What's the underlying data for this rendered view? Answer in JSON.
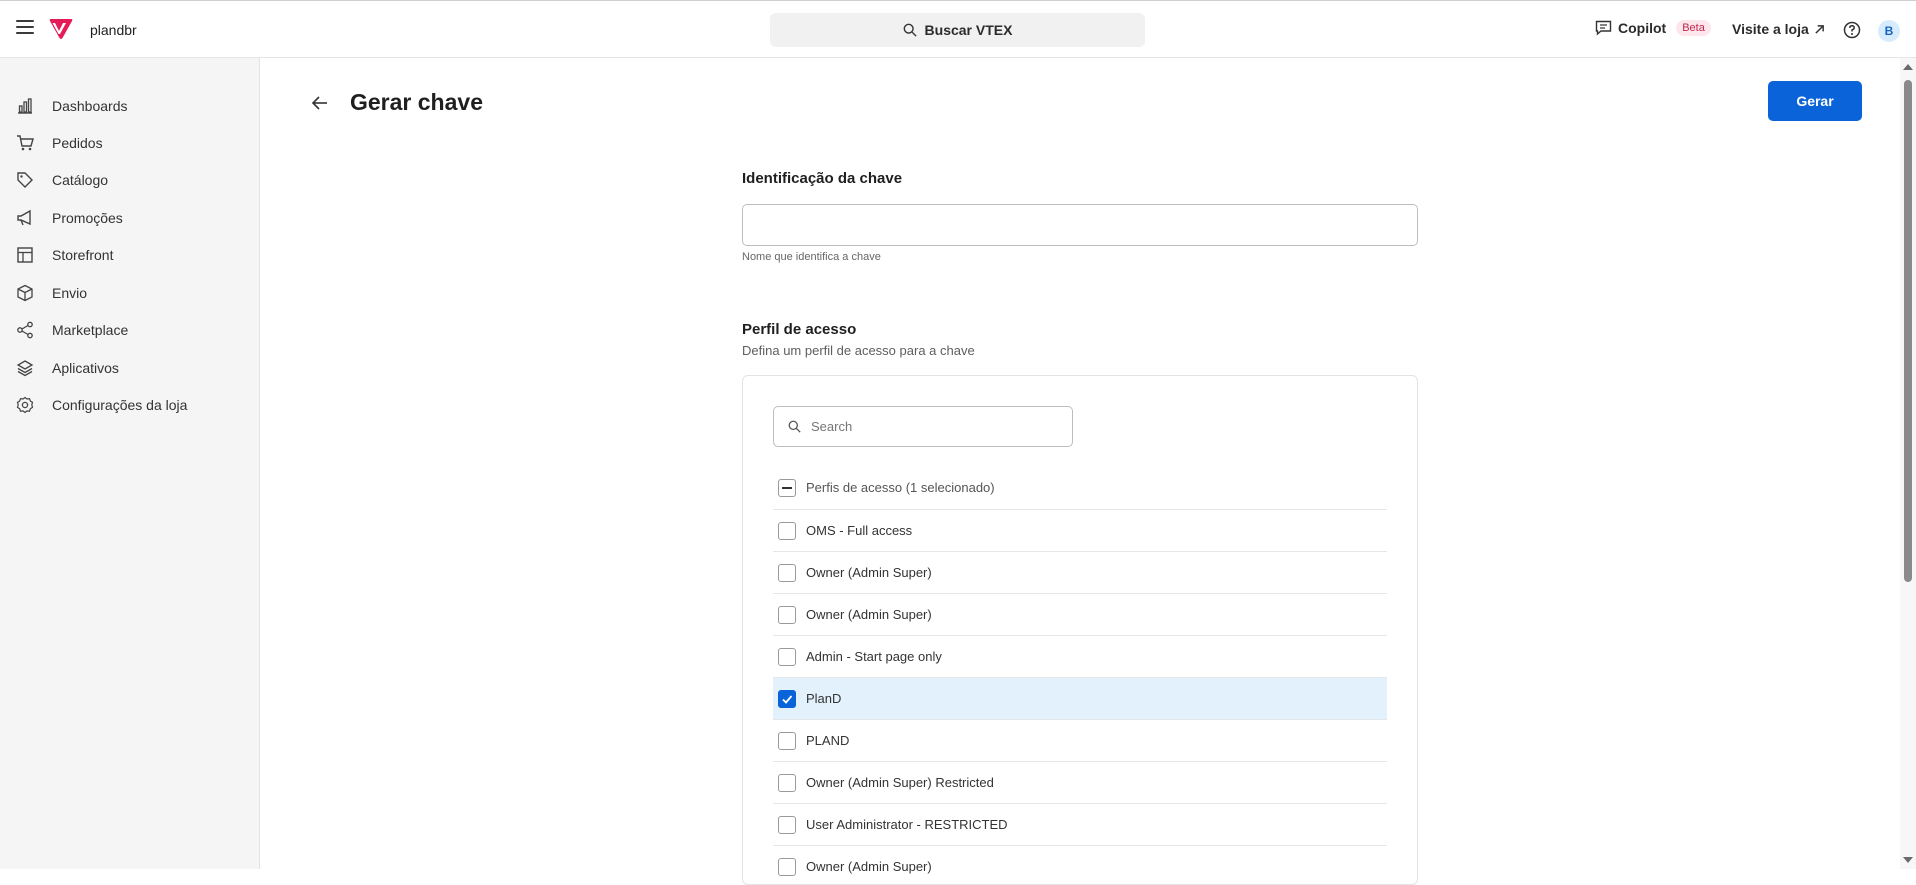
{
  "topbar": {
    "account_name": "plandbr",
    "search_label": "Buscar VTEX",
    "copilot_label": "Copilot",
    "beta_badge": "Beta",
    "visit_store_label": "Visite a loja",
    "avatar_initial": "B",
    "brand_color": "#e31c58"
  },
  "sidebar": {
    "items": [
      {
        "label": "Dashboards",
        "icon": "bar-chart-icon"
      },
      {
        "label": "Pedidos",
        "icon": "cart-icon"
      },
      {
        "label": "Catálogo",
        "icon": "tag-icon"
      },
      {
        "label": "Promoções",
        "icon": "megaphone-icon"
      },
      {
        "label": "Storefront",
        "icon": "layout-icon"
      },
      {
        "label": "Envio",
        "icon": "box-icon"
      },
      {
        "label": "Marketplace",
        "icon": "share-icon"
      },
      {
        "label": "Aplicativos",
        "icon": "layers-icon"
      },
      {
        "label": "Configurações da loja",
        "icon": "gear-icon"
      }
    ]
  },
  "page": {
    "title": "Gerar chave",
    "primary_button": "Gerar",
    "accent_color": "#0b63d9"
  },
  "key_section": {
    "label": "Identificação da chave",
    "value": "",
    "hint": "Nome que identifica a chave"
  },
  "profile_section": {
    "label": "Perfil de acesso",
    "description": "Defina um perfil de acesso para a chave",
    "search_placeholder": "Search",
    "list_header": "Perfis de acesso (1 selecionado)",
    "items": [
      {
        "label": "OMS - Full access",
        "checked": false
      },
      {
        "label": "Owner (Admin Super)",
        "checked": false
      },
      {
        "label": "Owner (Admin Super)",
        "checked": false
      },
      {
        "label": "Admin - Start page only",
        "checked": false
      },
      {
        "label": "PlanD",
        "checked": true
      },
      {
        "label": "PLAND",
        "checked": false
      },
      {
        "label": "Owner (Admin Super) Restricted",
        "checked": false
      },
      {
        "label": "User Administrator - RESTRICTED",
        "checked": false
      },
      {
        "label": "Owner (Admin Super)",
        "checked": false
      }
    ]
  }
}
